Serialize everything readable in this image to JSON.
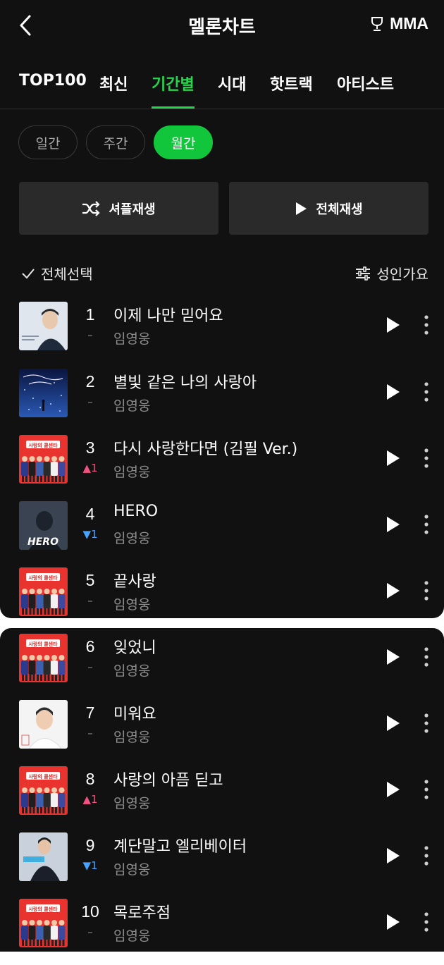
{
  "header": {
    "title": "멜론차트",
    "award_label": "MMA",
    "icons": {
      "back": "chevron-left-icon",
      "award": "trophy-icon"
    }
  },
  "tabs": [
    {
      "label": "TOP100",
      "active": false
    },
    {
      "label": "최신",
      "active": false
    },
    {
      "label": "기간별",
      "active": true
    },
    {
      "label": "시대",
      "active": false
    },
    {
      "label": "핫트랙",
      "active": false
    },
    {
      "label": "아티스트",
      "active": false
    }
  ],
  "periods": [
    {
      "label": "일간",
      "active": false
    },
    {
      "label": "주간",
      "active": false
    },
    {
      "label": "월간",
      "active": true
    }
  ],
  "actions": {
    "shuffle_label": "셔플재생",
    "play_all_label": "전체재생"
  },
  "list_controls": {
    "select_all_label": "전체선택",
    "adult_filter_label": "성인가요"
  },
  "songs": [
    {
      "rank": "1",
      "change": "–",
      "direction": "same",
      "title": "이제 나만 믿어요",
      "artist": "임영웅",
      "cover": "portrait-light"
    },
    {
      "rank": "2",
      "change": "–",
      "direction": "same",
      "title": "별빛 같은 나의 사랑아",
      "artist": "임영웅",
      "cover": "night-sky"
    },
    {
      "rank": "3",
      "change": "▲1",
      "direction": "up",
      "title": "다시 사랑한다면 (김필 Ver.)",
      "artist": "임영웅",
      "cover": "red-group"
    },
    {
      "rank": "4",
      "change": "▼1",
      "direction": "down",
      "title": "HERO",
      "artist": "임영웅",
      "cover": "hero"
    },
    {
      "rank": "5",
      "change": "–",
      "direction": "same",
      "title": "끝사랑",
      "artist": "임영웅",
      "cover": "red-group"
    },
    {
      "rank": "6",
      "change": "–",
      "direction": "same",
      "title": "잊었니",
      "artist": "임영웅",
      "cover": "red-group"
    },
    {
      "rank": "7",
      "change": "–",
      "direction": "same",
      "title": "미워요",
      "artist": "임영웅",
      "cover": "portrait-white"
    },
    {
      "rank": "8",
      "change": "▲1",
      "direction": "up",
      "title": "사랑의 아픔 딛고",
      "artist": "임영웅",
      "cover": "red-group"
    },
    {
      "rank": "9",
      "change": "▼1",
      "direction": "down",
      "title": "계단말고 엘리베이터",
      "artist": "임영웅",
      "cover": "portrait-suit"
    },
    {
      "rank": "10",
      "change": "–",
      "direction": "same",
      "title": "목로주점",
      "artist": "임영웅",
      "cover": "red-group"
    }
  ],
  "colors": {
    "background": "#111111",
    "accent_green": "#27d34f",
    "rank_up": "#f25182",
    "rank_down": "#46a3ff",
    "muted_text": "#8c8c8c"
  },
  "album_text": {
    "red_group": "사랑의 콜센타",
    "hero": "HERO"
  }
}
